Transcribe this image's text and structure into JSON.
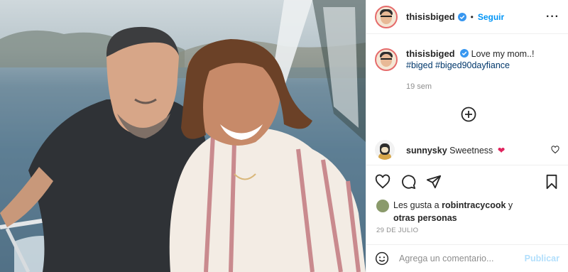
{
  "post": {
    "photo": {
      "alt": "",
      "colors": {
        "sky": "#cfd8dc",
        "sea": "#5f7f95",
        "shirt_dark": "#2f3236",
        "blouse": "#f3ece4",
        "stripe": "#c98a8e"
      }
    },
    "header": {
      "username": "thisisbiged",
      "verified_icon": "verified-badge-icon",
      "separator": "•",
      "follow_label": "Seguir",
      "more_label": "···"
    },
    "caption": {
      "username": "thisisbiged",
      "text": "Love my mom..!",
      "hashtags": [
        "#biged",
        "#biged90dayfiance"
      ],
      "time": "19 sem"
    },
    "load_more_icon": "plus-circle-icon",
    "comments": [
      {
        "username": "sunnysky",
        "text": "Sweetness",
        "emoji": "❤"
      }
    ],
    "actions": {
      "like_icon": "heart-icon",
      "comment_icon": "comment-icon",
      "share_icon": "paper-plane-icon",
      "save_icon": "bookmark-icon"
    },
    "likes": {
      "prefix": "Les gusta a",
      "user": "robintracycook",
      "joiner": "y",
      "others": "otras personas"
    },
    "date": "29 DE JULIO",
    "comment_box": {
      "placeholder": "Agrega un comentario...",
      "publish_label": "Publicar"
    },
    "colors": {
      "link": "#0095f6",
      "hashtag": "#00376b",
      "muted": "#8e8e8e",
      "publish_disabled": "#b2dffc"
    }
  }
}
